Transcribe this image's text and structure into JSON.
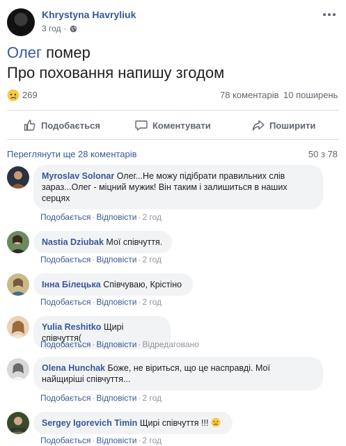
{
  "post": {
    "author": "Khrystyna Havryliuk",
    "time": "3 год",
    "mention": "Олег",
    "line1_rest": " помер",
    "line2": "Про поховання напишу згодом",
    "reaction_count": "269",
    "comments_count": "78 коментарів",
    "shares_count": "10 поширень"
  },
  "actions": {
    "like": "Подобається",
    "comment": "Коментувати",
    "share": "Поширити"
  },
  "comments_header": {
    "view_more": "Переглянути ще 28 коментарів",
    "pager": "50 з 78"
  },
  "comment_labels": {
    "like": "Подобається",
    "reply": "Відповісти",
    "edited": "Відредаговано"
  },
  "comments": [
    {
      "name": "Myroslav Solonar",
      "text": "Олег...Не можу підібрати правильних слів зараз...Олег - міцний мужик! Він таким і залишиться в наших серцях",
      "time": "2 год",
      "avatar_color": "#5a4a3a"
    },
    {
      "name": "Nastia Dziubak",
      "text": "Мої співчуття.",
      "time": "2 год",
      "avatar_color": "#4f6b4a"
    },
    {
      "name": "Інна Білецька",
      "text": "Співчуваю, Крістіно",
      "time": "2 год",
      "avatar_color": "#8a7a5a"
    },
    {
      "name": "Yulia Reshitko",
      "text": "Щирі співчуття(",
      "time": "",
      "avatar_color": "#b89070"
    },
    {
      "name": "Olena Hunchak",
      "text": "Боже, не віриться, що це насправді. Мої найщиріші співчуття...",
      "time": "2 год",
      "avatar_color": "#9a9a9a"
    },
    {
      "name": "Sergey Igorevich Timin",
      "text": "Щирі співчуття !!!",
      "time": "2 год",
      "avatar_color": "#5a6a3a"
    }
  ]
}
